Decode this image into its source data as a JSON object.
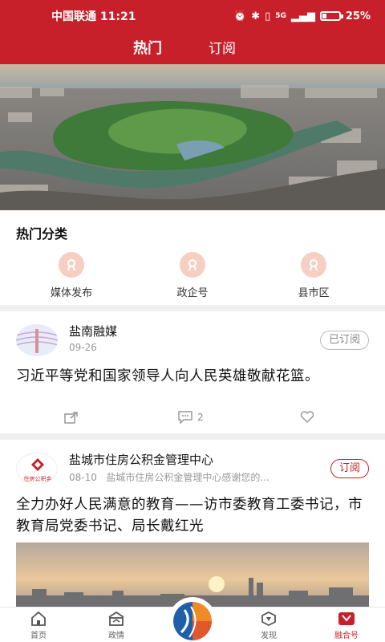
{
  "status_bar": {
    "carrier": "中国联通 11:21",
    "signal": "5G",
    "battery": "25%",
    "battery_level": 0.25
  },
  "header": {
    "tabs": [
      {
        "label": "热门",
        "active": true
      },
      {
        "label": "订阅",
        "active": false
      }
    ]
  },
  "hot_categories": {
    "title": "热门分类",
    "items": [
      {
        "label": "媒体发布"
      },
      {
        "label": "政企号"
      },
      {
        "label": "县市区"
      }
    ]
  },
  "posts": [
    {
      "author": "盐南融媒",
      "date": "09-26",
      "subscribe_label": "已订阅",
      "title": "习近平等党和国家领导人向人民英雄敬献花篮。",
      "comment_count": "2"
    },
    {
      "author": "盐城市住房公积金管理中心",
      "date": "08-10",
      "excerpt": "盐城市住房公积金管理中心感谢您的...",
      "avatar_text": "住房公积金",
      "subscribe_label": "订阅",
      "title": "全力办好人民满意的教育——访市委教育工委书记，市教育局党委书记、局长戴红光"
    }
  ],
  "bottom_nav": [
    {
      "label": "首页",
      "icon": "home-icon"
    },
    {
      "label": "政情",
      "icon": "government-icon"
    },
    {
      "label": "发现",
      "icon": "discover-icon"
    },
    {
      "label": "融合号",
      "icon": "rongheha-icon",
      "active": true
    }
  ],
  "colors": {
    "brand_red": "#c8202a",
    "category_icon_bg": "#f6cfc3"
  }
}
